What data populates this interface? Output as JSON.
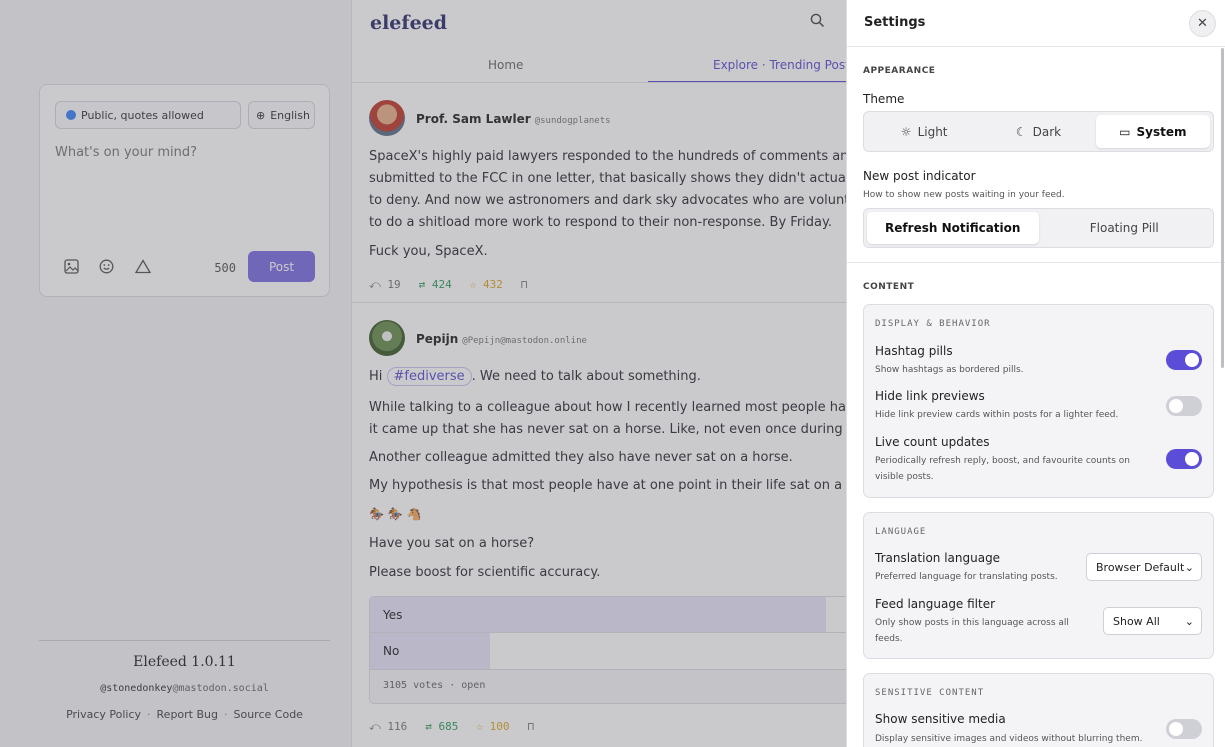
{
  "composer": {
    "visibility": "Public, quotes allowed",
    "language": "English",
    "placeholder": "What's on your mind?",
    "char_count": "500",
    "post_label": "Post"
  },
  "footer": {
    "version": "Elefeed 1.0.11",
    "account_user": "@stonedonkey",
    "account_server": "@mastodon.social",
    "links": [
      "Privacy Policy",
      "Report Bug",
      "Source Code"
    ],
    "separator": "·"
  },
  "header": {
    "logo": "elefeed",
    "tabs": [
      "Home",
      "Explore · Trending Posts"
    ]
  },
  "posts": [
    {
      "name": "Prof. Sam Lawler",
      "handle": "@sundogplanets",
      "lines": [
        "SpaceX's highly paid lawyers responded to the hundreds of comments and opp",
        "submitted to the FCC in one letter, that basically shows they didn't actually rea",
        "to deny. And now we astronomers and dark sky advocates who are volunteerin",
        "to do a shitload more work to respond to their non-response. By Friday."
      ],
      "line2": "Fuck you, SpaceX.",
      "replies": "19",
      "boosts": "424",
      "favs": "432"
    },
    {
      "name": "Pepijn",
      "handle": "@Pepijn@mastodon.online",
      "hi": "Hi",
      "hashtag": "#fediverse",
      "hi_rest": ". We need to talk about something.",
      "lines": [
        "While talking to a colleague about how I recently learned most people have nev",
        "it came up that she has never sat on a horse. Like, not even once during childho"
      ],
      "line3": "Another colleague admitted they also have never sat on a horse.",
      "line4": "My hypothesis is that most people have at one point in their life sat on a horse",
      "emojis": "🏇 🏇 🐴",
      "line5": "Have you sat on a horse?",
      "line6": "Please boost for scientific accuracy.",
      "poll": [
        {
          "label": "Yes",
          "fraction": 0.91
        },
        {
          "label": "No",
          "fraction": 0.24
        }
      ],
      "poll_meta": "3105 votes · open",
      "replies": "116",
      "boosts": "685",
      "favs": "100"
    }
  ],
  "settings": {
    "title": "Settings",
    "appearance_heading": "APPEARANCE",
    "theme_label": "Theme",
    "theme_options": [
      "Light",
      "Dark",
      "System"
    ],
    "theme_selected": "System",
    "indicator_label": "New post indicator",
    "indicator_sub": "How to show new posts waiting in your feed.",
    "indicator_options": [
      "Refresh Notification",
      "Floating Pill"
    ],
    "indicator_selected": "Refresh Notification",
    "content_heading": "CONTENT",
    "display": {
      "heading": "DISPLAY & BEHAVIOR",
      "items": [
        {
          "label": "Hashtag pills",
          "sub": "Show hashtags as bordered pills.",
          "on": true
        },
        {
          "label": "Hide link previews",
          "sub": "Hide link preview cards within posts for a lighter feed.",
          "on": false
        },
        {
          "label": "Live count updates",
          "sub": "Periodically refresh reply, boost, and favourite counts on",
          "sub2": "visible posts.",
          "on": true
        }
      ]
    },
    "language": {
      "heading": "LANGUAGE",
      "translation_label": "Translation language",
      "translation_sub": "Preferred language for translating posts.",
      "translation_value": "Browser Default",
      "filter_label": "Feed language filter",
      "filter_sub": "Only show posts in this language across all",
      "filter_sub2": "feeds.",
      "filter_value": "Show All"
    },
    "sensitive": {
      "heading": "SENSITIVE CONTENT",
      "label": "Show sensitive media",
      "sub": "Display sensitive images and videos without blurring them.",
      "on": false
    }
  },
  "colors": {
    "accent": "#5b4dd8",
    "post_button": "#7c6ee0",
    "boost": "#2a9d5c",
    "fav": "#e0a526"
  }
}
